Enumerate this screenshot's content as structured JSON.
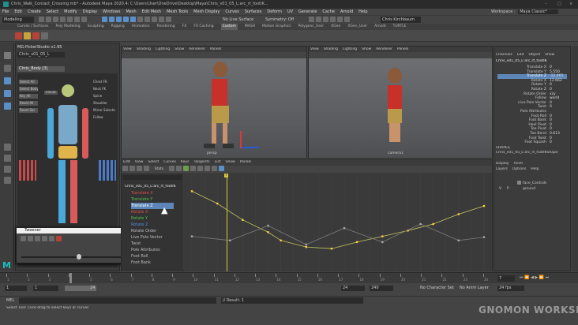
{
  "title_bar": {
    "text": "Chris_Walk_Contact_Crossing.mb* - Autodesk Maya 2020.4: C:\\Users\\User\\OneDrive\\Desktop\\Maya\\Chris_v01_05_L:arc_rt_footIK...",
    "workspace_label": "Workspace :",
    "workspace_value": "Maya Classic*"
  },
  "menu": [
    "File",
    "Edit",
    "Create",
    "Select",
    "Modify",
    "Display",
    "Windows",
    "Mesh",
    "Edit Mesh",
    "Mesh Tools",
    "Mesh Display",
    "Curves",
    "Surfaces",
    "Deform",
    "UV",
    "Generate",
    "Cache",
    "Arnold",
    "Help"
  ],
  "status": {
    "mode": "Modeling",
    "no_live_surface": "No Live Surface",
    "symmetry": "Symmetry: Off",
    "user": "Chris Kirchbaum"
  },
  "shelf_tabs": [
    "Curves / Surfaces",
    "Poly Modeling",
    "Sculpting",
    "Rigging",
    "Animation",
    "Rendering",
    "FX",
    "FX Caching",
    "Custom",
    "MASH",
    "Motion Graphics",
    "Polygons_User",
    "XGen",
    "XGen_User",
    "Arnold",
    "TURTLE"
  ],
  "shelf_active": "Custom",
  "picker": {
    "title": "MG-PickerStudio v1.95",
    "character": "Chris_v01_05_L",
    "tab": "Chris_Body [3]",
    "buttons": [
      "Select All",
      "Select Body",
      "Key All",
      "Reset All",
      "Reset Sel"
    ],
    "right_labels": [
      "Chest FK",
      "Neck FK",
      "Spine",
      "Shoulder",
      "Mirror Selection",
      "Follow"
    ],
    "local_label": "Facial"
  },
  "viewport_menus": [
    "View",
    "Shading",
    "Lighting",
    "Show",
    "Renderer",
    "Panels"
  ],
  "viewport_labels": [
    "persp",
    "camera1"
  ],
  "graph_editor": {
    "menus": [
      "Edit",
      "View",
      "Select",
      "Curves",
      "Keys",
      "Tangents",
      "List",
      "Show",
      "Panels"
    ],
    "stats_label": "Stats",
    "outliner_root": "Chris_v01_05_L:arc_rt_footIK",
    "curves": [
      "Translate X",
      "Translate Y",
      "Translate Z",
      "Rotate X",
      "Rotate Y",
      "Rotate Z",
      "Rotate Order",
      "Live Pole Vector",
      "Twist",
      "Pole Attributes",
      "Foot Roll",
      "Foot Bank"
    ],
    "selected_curve": "Translate Z",
    "frame_marker": "7"
  },
  "channel_box": {
    "tabs": [
      "Channels",
      "Edit",
      "Object",
      "Show"
    ],
    "node": "Chris_v01_05_L:arc_rt_footIK",
    "attrs": [
      {
        "name": "Translate X",
        "value": "0"
      },
      {
        "name": "Translate Y",
        "value": "5.550"
      },
      {
        "name": "Translate Z",
        "value": "-12.465"
      },
      {
        "name": "Rotate X",
        "value": "12.662"
      },
      {
        "name": "Rotate Y",
        "value": "0"
      },
      {
        "name": "Rotate Z",
        "value": "0"
      },
      {
        "name": "Rotate Order",
        "value": "xzy"
      },
      {
        "name": "Follow",
        "value": "world"
      },
      {
        "name": "Live Pole Vector",
        "value": "0"
      },
      {
        "name": "Twist",
        "value": "0"
      },
      {
        "name": "Pole Attributes",
        "value": ""
      },
      {
        "name": "Foot Roll",
        "value": "0"
      },
      {
        "name": "Foot Bank",
        "value": "0"
      },
      {
        "name": "Heel Pivot",
        "value": "0"
      },
      {
        "name": "Toe Pivot",
        "value": "0"
      },
      {
        "name": "Toe Bend",
        "value": "0.613"
      },
      {
        "name": "Foot Twist",
        "value": "0"
      },
      {
        "name": "Foot Squash",
        "value": "0"
      }
    ],
    "shapes_label": "SHAPES",
    "shape_node": "Chris_v01_05_L:arc_rt_footIKShape"
  },
  "layers": {
    "tabs": [
      "Display",
      "Anim"
    ],
    "menus": [
      "Layers",
      "Options",
      "Help"
    ],
    "items": [
      {
        "name": "face_Controls"
      },
      {
        "name": "ground"
      }
    ],
    "v": "V",
    "p": "P"
  },
  "tweener": {
    "title": "Tweener"
  },
  "time": {
    "current": "7",
    "start": "1",
    "start2": "1",
    "end_inner": "24",
    "end": "24",
    "end2": "240",
    "fps": "24 fps",
    "no_character": "No Character Set",
    "no_anim_layer": "No Anim Layer",
    "ticks": [
      "1",
      "2",
      "3",
      "4",
      "5",
      "6",
      "7",
      "8",
      "9",
      "10",
      "11",
      "12",
      "13",
      "14",
      "15",
      "16",
      "17",
      "18",
      "19",
      "20",
      "21",
      "22",
      "23",
      "24"
    ]
  },
  "command": {
    "label": "MEL",
    "result": "// Result: 1",
    "help": "Select Tool: Click-drag to select keys or curves"
  },
  "watermark": "GNOMON WORKSHOP",
  "side_tabs": [
    "Channel Box / Layer Editor",
    "Modeling Toolkit",
    "Attribute Editor"
  ],
  "chart_data": {
    "type": "line",
    "title": "",
    "xlabel": "",
    "ylabel": "",
    "xlim": [
      1,
      24
    ],
    "series": [
      {
        "name": "Translate Z",
        "x": [
          1,
          3,
          5,
          7,
          8,
          10,
          12,
          14,
          16,
          18,
          20,
          22,
          24
        ],
        "y": [
          0.9,
          0.75,
          0.55,
          0.4,
          0.3,
          0.22,
          0.2,
          0.28,
          0.35,
          0.42,
          0.5,
          0.62,
          0.72
        ]
      },
      {
        "name": "Translate Y",
        "x": [
          1,
          4,
          7,
          10,
          13,
          16,
          19,
          22,
          24
        ],
        "y": [
          0.35,
          0.3,
          0.48,
          0.25,
          0.45,
          0.28,
          0.5,
          0.3,
          0.34
        ]
      }
    ]
  }
}
